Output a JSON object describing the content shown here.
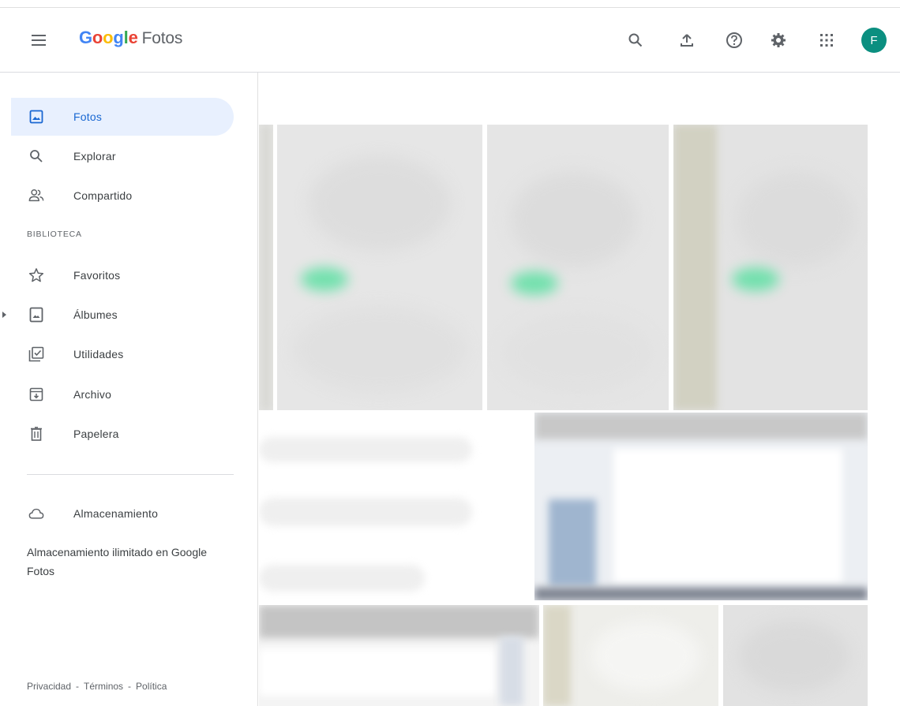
{
  "header": {
    "logo_brand": "Google",
    "logo_product": "Fotos",
    "avatar_initial": "F"
  },
  "sidebar": {
    "items": [
      {
        "label": "Fotos",
        "icon": "photo-icon",
        "active": true
      },
      {
        "label": "Explorar",
        "icon": "search-icon"
      },
      {
        "label": "Compartido",
        "icon": "people-icon"
      }
    ],
    "library_heading": "BIBLIOTECA",
    "library_items": [
      {
        "label": "Favoritos",
        "icon": "star-icon"
      },
      {
        "label": "Álbumes",
        "icon": "album-icon"
      },
      {
        "label": "Utilidades",
        "icon": "utilities-icon"
      },
      {
        "label": "Archivo",
        "icon": "archive-icon"
      },
      {
        "label": "Papelera",
        "icon": "trash-icon"
      }
    ],
    "storage_label": "Almacenamiento",
    "storage_description": "Almacenamiento ilimitado en Google Fotos",
    "footer": {
      "privacy": "Privacidad",
      "terms": "Términos",
      "policy": "Política"
    }
  },
  "colors": {
    "accent": "#1967d2",
    "active_bg": "#e8f0fe",
    "avatar": "#0b8f80",
    "google_blue": "#4285f4",
    "google_red": "#ea4335",
    "google_yellow": "#fbbc05",
    "google_green": "#34a853"
  }
}
